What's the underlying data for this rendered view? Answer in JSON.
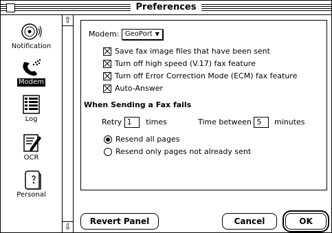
{
  "window": {
    "title": "Preferences"
  },
  "sidebar": {
    "items": [
      {
        "label": "Notification",
        "icon": "speaker-icon",
        "selected": false
      },
      {
        "label": "Modem",
        "icon": "phone-icon",
        "selected": true
      },
      {
        "label": "Log",
        "icon": "log-icon",
        "selected": false
      },
      {
        "label": "OCR",
        "icon": "ocr-icon",
        "selected": false
      },
      {
        "label": "Personal",
        "icon": "personal-icon",
        "selected": false
      }
    ]
  },
  "modem": {
    "label": "Modem:",
    "selected": "GeoPort",
    "options": [
      {
        "label": "Save fax image files that have been sent",
        "checked": true
      },
      {
        "label": "Turn off high speed (V.17) fax feature",
        "checked": true
      },
      {
        "label": "Turn off Error Correction Mode (ECM) fax feature",
        "checked": true
      },
      {
        "label": "Auto-Answer",
        "checked": true
      }
    ]
  },
  "failure": {
    "heading": "When Sending a Fax fails",
    "retry_label": "Retry",
    "retry_value": "1",
    "times_label": "times",
    "between_label": "Time between",
    "between_value": "5",
    "minutes_label": "minutes",
    "radios": [
      {
        "label": "Resend all pages",
        "selected": true
      },
      {
        "label": "Resend only pages not already sent",
        "selected": false
      }
    ]
  },
  "buttons": {
    "revert": "Revert Panel",
    "cancel": "Cancel",
    "ok": "OK"
  }
}
